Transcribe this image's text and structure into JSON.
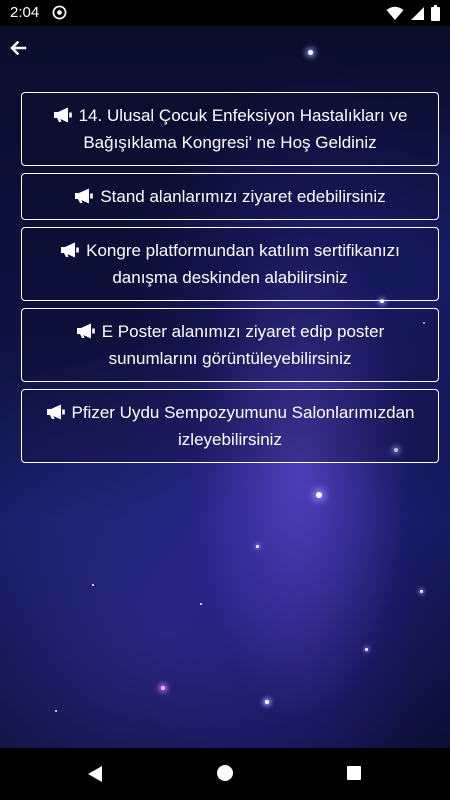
{
  "status_bar": {
    "time": "2:04",
    "left_icon": "sync-icon",
    "right_icons": [
      "wifi-icon",
      "cellular-icon",
      "battery-icon"
    ]
  },
  "header": {
    "back_icon": "arrow-left-icon"
  },
  "announcements": [
    {
      "icon": "megaphone-icon",
      "text": "14. Ulusal Çocuk Enfeksiyon Hastalıkları ve Bağışıklama Kongresi' ne Hoş Geldiniz"
    },
    {
      "icon": "megaphone-icon",
      "text": "Stand alanlarımızı ziyaret edebilirsiniz"
    },
    {
      "icon": "megaphone-icon",
      "text": "Kongre platformundan katılım sertifikanızı danışma deskinden alabilirsiniz"
    },
    {
      "icon": "megaphone-icon",
      "text": "E Poster alanımızı ziyaret edip poster sunumlarını görüntüleyebilirsiniz"
    },
    {
      "icon": "megaphone-icon",
      "text": "Pfizer Uydu Sempozyumunu Salonlarımızdan izleyebilirsiniz"
    }
  ],
  "nav_bar": {
    "icons": [
      "nav-back-icon",
      "nav-home-icon",
      "nav-recents-icon"
    ]
  },
  "colors": {
    "card_border": "#ffffff",
    "text": "#ffffff",
    "background": "#0d1240"
  }
}
